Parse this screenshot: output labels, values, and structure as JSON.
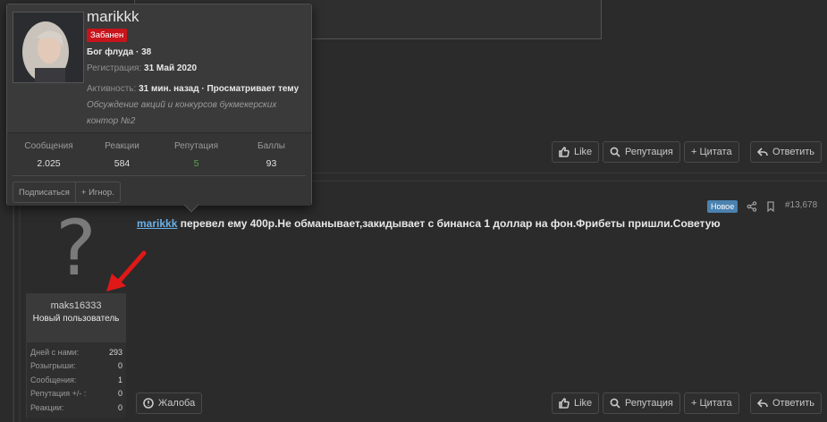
{
  "user_card": {
    "username": "marikkk",
    "banned_label": "Забанен",
    "rank": "Бог флуда · 38",
    "registration_label": "Регистрация:",
    "registration_date": "31 Май 2020",
    "activity_label": "Активность:",
    "activity_text": "31 мин. назад · Просматривает тему",
    "thread_title": "Обсуждение акций и конкурсов букмекерских контор №2",
    "stats": [
      {
        "label": "Сообщения",
        "value": "2.025"
      },
      {
        "label": "Реакции",
        "value": "584"
      },
      {
        "label": "Репутация",
        "value": "5"
      },
      {
        "label": "Баллы",
        "value": "93"
      }
    ],
    "follow_label": "Подписаться",
    "ignore_label": "+ Игнор."
  },
  "post_actions_top": {
    "like": "Like",
    "reputation": "Репутация",
    "quote": "+ Цитата",
    "reply": "Ответить"
  },
  "post": {
    "badge_new": "Новое",
    "post_number": "#13,678",
    "mention": "marikkk",
    "message": " перевел ему 400р.Не обманывает,закидывает с бинанса 1 доллар на фон.Фрибеты пришли.Советую",
    "author": {
      "avatar_glyph": "?",
      "username": "maks16333",
      "title": "Новый пользователь",
      "stats": [
        {
          "label": "Дней с нами:",
          "value": "293"
        },
        {
          "label": "Розыгрыши:",
          "value": "0"
        },
        {
          "label": "Сообщения:",
          "value": "1"
        },
        {
          "label": "Репутация +/- :",
          "value": "0"
        },
        {
          "label": "Реакции:",
          "value": "0"
        }
      ]
    },
    "report": "Жалоба",
    "actions": {
      "like": "Like",
      "reputation": "Репутация",
      "quote": "+ Цитата",
      "reply": "Ответить"
    }
  },
  "colors": {
    "banned": "#c8141b",
    "badge_new": "#4a82b0",
    "reputation_value": "#5da64d",
    "mention": "#6ab0e8",
    "arrow": "#e01818"
  },
  "icons": [
    "thumbs-up-icon",
    "search-icon",
    "reply-icon",
    "share-icon",
    "bookmark-icon",
    "report-icon",
    "arrow-annotation"
  ]
}
